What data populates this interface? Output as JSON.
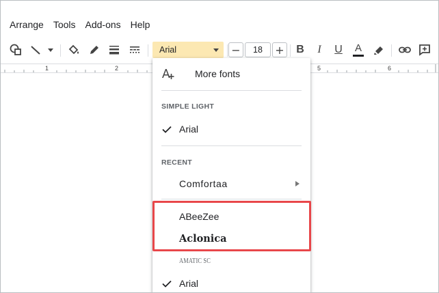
{
  "menubar": {
    "items": [
      "Arrange",
      "Tools",
      "Add-ons",
      "Help"
    ]
  },
  "toolbar": {
    "font_family": "Arial",
    "font_size": "18",
    "decrease_label": "−",
    "increase_label": "+",
    "bold_label": "B",
    "italic_label": "I",
    "underline_label": "U",
    "text_color_label": "A",
    "text_color": "#202124",
    "highlight_color": "#fce8b2"
  },
  "ruler": {
    "numbers": [
      "1",
      "2",
      "5",
      "6"
    ]
  },
  "font_menu": {
    "more_fonts_label": "More fonts",
    "theme_heading": "SIMPLE LIGHT",
    "theme_fonts": [
      {
        "label": "Arial",
        "checked": true
      }
    ],
    "recent_heading": "RECENT",
    "recent_fonts": [
      {
        "label": "Comfortaa",
        "has_submenu": true
      }
    ],
    "fonts": [
      {
        "label": "ABeeZee",
        "highlighted": true
      },
      {
        "label": "Aclonica",
        "highlighted": true
      },
      {
        "label": "AMATIC SC",
        "highlighted": false
      },
      {
        "label": "Arial",
        "checked": true
      }
    ],
    "highlight_border_color": "#e8474a"
  }
}
